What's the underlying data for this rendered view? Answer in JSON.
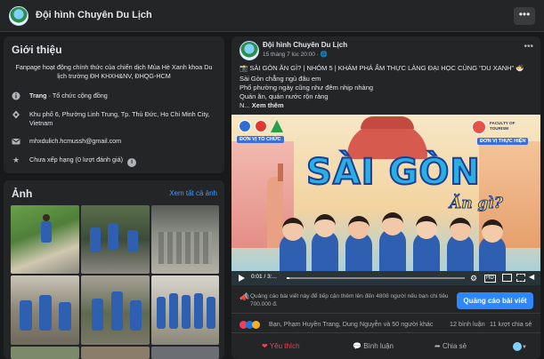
{
  "header": {
    "title": "Đội hình Chuyên Du Lịch",
    "more_icon": "ellipsis-icon"
  },
  "intro": {
    "heading": "Giới thiệu",
    "description": "Fanpage hoạt động chính thức của chiến dịch Mùa Hè Xanh khoa Du lịch trường ĐH KHXH&NV, ĐHQG-HCM",
    "page_type_label": "Trang",
    "page_type_value": " · Tổ chức cộng đồng",
    "address": "Khu phố 6, Phường Linh Trung, Tp. Thủ Đức, Ho Chi Minh City, Vietnam",
    "email": "mhxdulich.hcmussh@gmail.com",
    "rating": "Chưa xếp hạng (0 lượt đánh giá)"
  },
  "photos": {
    "heading": "Ảnh",
    "see_all": "Xem tất cả ảnh"
  },
  "post": {
    "author": "Đội hình Chuyên Du Lịch",
    "time": "15 tháng 7 lúc 20:00 · ",
    "line1": "📸 SÀI GÒN ĂN GÌ? | NHÓM 5 | KHÁM PHÁ ẨM THỰC LÀNG ĐẠI HỌC CÙNG \"DU XANH\" 🍜",
    "line2": "Sài Gòn chẳng ngủ đâu em",
    "line3": "Phố phường ngày cũng như đêm nhịp nhàng",
    "line4": "Quán ăn, quán nước rộn ràng",
    "line5_prefix": "N... ",
    "see_more": "Xem thêm",
    "media": {
      "left_label": "ĐƠN VỊ TỔ CHỨC",
      "right_label": "ĐƠN VỊ THỰC HIỆN",
      "faculty_label": "FACULTY OF TOURISM",
      "headline": "SÀI GÒN",
      "subline": "Ăn gì?",
      "time_display": "0:01 / 3:..."
    },
    "boost_text": "Quảng cáo bài viết này để tiếp cận thêm lên đến 4808 người nếu bạn chi tiêu 700.000 đ.",
    "boost_button": "Quảng cáo bài viết",
    "reactions": "Bạn, Phạm Huyền Trang, Dung Nguyễn và 50 người khác",
    "comments": "12 bình luận",
    "shares": "11 lượt chia sẻ",
    "like": "Yêu thích",
    "comment": "Bình luận",
    "share": "Chia sẻ"
  }
}
